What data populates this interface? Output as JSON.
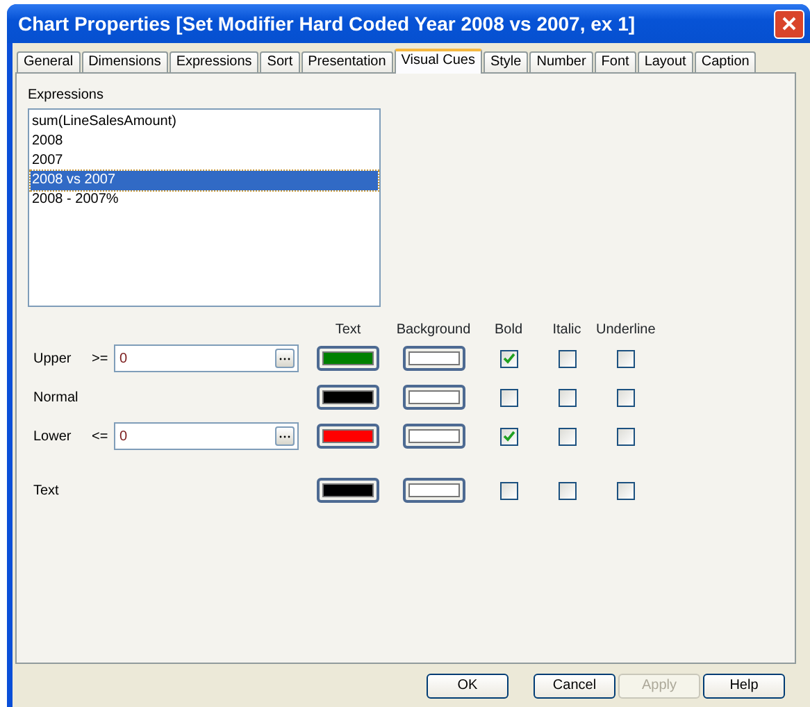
{
  "window": {
    "title": "Chart Properties [Set Modifier Hard Coded Year 2008 vs 2007, ex 1]"
  },
  "tabs": [
    {
      "label": "General",
      "selected": false
    },
    {
      "label": "Dimensions",
      "selected": false
    },
    {
      "label": "Expressions",
      "selected": false
    },
    {
      "label": "Sort",
      "selected": false
    },
    {
      "label": "Presentation",
      "selected": false
    },
    {
      "label": "Visual Cues",
      "selected": true
    },
    {
      "label": "Style",
      "selected": false
    },
    {
      "label": "Number",
      "selected": false
    },
    {
      "label": "Font",
      "selected": false
    },
    {
      "label": "Layout",
      "selected": false
    },
    {
      "label": "Caption",
      "selected": false
    }
  ],
  "expressions": {
    "label": "Expressions",
    "items": [
      {
        "text": "sum(LineSalesAmount)",
        "selected": false
      },
      {
        "text": "2008",
        "selected": false
      },
      {
        "text": "2007",
        "selected": false
      },
      {
        "text": "2008 vs 2007",
        "selected": true
      },
      {
        "text": "2008 - 2007%",
        "selected": false
      }
    ]
  },
  "cues": {
    "columns": [
      "Text",
      "Background",
      "Bold",
      "Italic",
      "Underline"
    ],
    "rows": [
      {
        "label": "Upper",
        "operator": ">=",
        "value": "0",
        "text_swatch": {
          "color": "#008000"
        },
        "background_swatch": {
          "color": "#ffffff"
        },
        "bold": true,
        "italic": false,
        "underline": false
      },
      {
        "label": "Normal",
        "text_swatch": {
          "color": "#000000"
        },
        "background_swatch": {
          "color": "#ffffff"
        },
        "bold": false,
        "italic": false,
        "underline": false
      },
      {
        "label": "Lower",
        "operator": "<=",
        "value": "0",
        "text_swatch": {
          "color": "#ff0000"
        },
        "background_swatch": {
          "color": "#ffffff"
        },
        "bold": true,
        "italic": false,
        "underline": false
      },
      {
        "label": "Text",
        "text_swatch": {
          "color": "#000000"
        },
        "background_swatch": {
          "color": "#ffffff"
        },
        "bold": false,
        "italic": false,
        "underline": false
      }
    ]
  },
  "buttons": [
    {
      "label": "OK",
      "disabled": false
    },
    {
      "label": "Cancel",
      "disabled": false
    },
    {
      "label": "Apply",
      "disabled": true
    },
    {
      "label": "Help",
      "disabled": false
    }
  ]
}
